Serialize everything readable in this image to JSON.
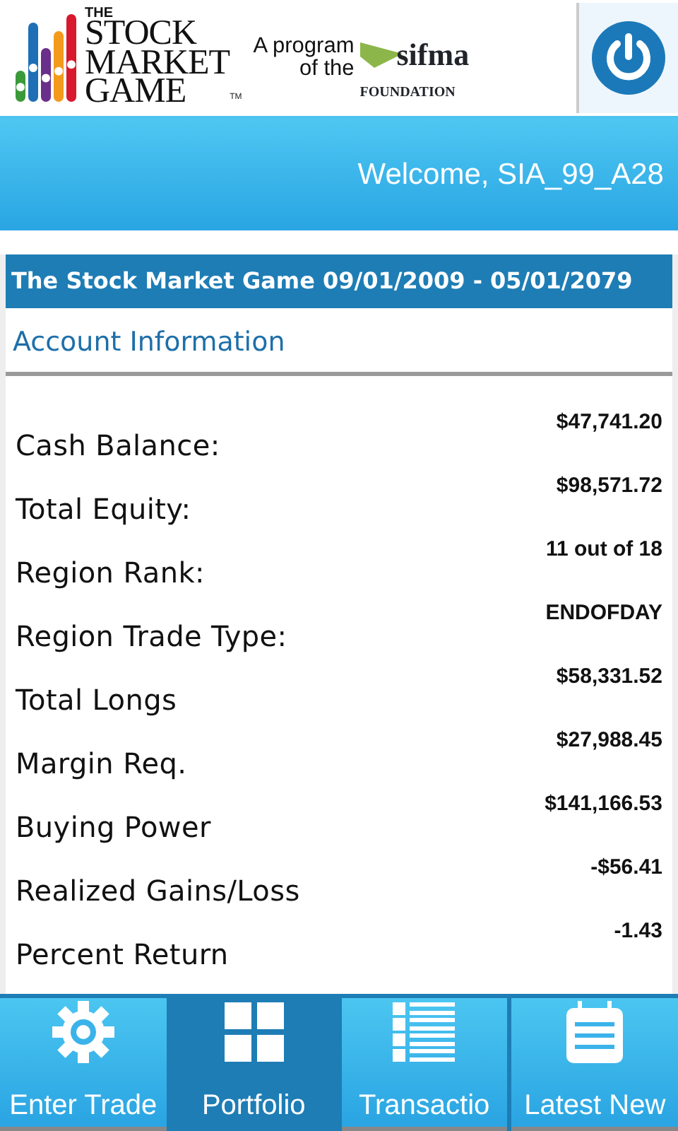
{
  "header": {
    "logo_lines": [
      "THE",
      "STOCK",
      "MARKET",
      "GAME"
    ],
    "trademark": "TM",
    "program_text": [
      "A program",
      "of the"
    ],
    "sponsor": "sifma",
    "sponsor_sub": "FOUNDATION"
  },
  "welcome": "Welcome, SIA_99_A28",
  "game_title": "The Stock Market Game 09/01/2009 - 05/01/2079",
  "section_title": "Account Information",
  "rows": [
    {
      "label": "Cash Balance:",
      "value": "$47,741.20"
    },
    {
      "label": "Total Equity:",
      "value": "$98,571.72"
    },
    {
      "label": "Region Rank:",
      "value": "11 out of 18"
    },
    {
      "label": "Region Trade Type:",
      "value": "ENDOFDAY"
    },
    {
      "label": "Total Longs",
      "value": "$58,331.52"
    },
    {
      "label": "Margin Req.",
      "value": "$27,988.45"
    },
    {
      "label": "Buying Power",
      "value": "$141,166.53"
    },
    {
      "label": "Realized Gains/Loss",
      "value": "-$56.41"
    },
    {
      "label": "Percent Return",
      "value": "-1.43"
    }
  ],
  "tabs": [
    {
      "label": "Enter Trade",
      "kind": "gear",
      "selected": false
    },
    {
      "label": "Portfolio",
      "kind": "grid",
      "selected": true
    },
    {
      "label": "Transactio",
      "kind": "list",
      "selected": false
    },
    {
      "label": "Latest New",
      "kind": "calendar",
      "selected": false
    }
  ]
}
